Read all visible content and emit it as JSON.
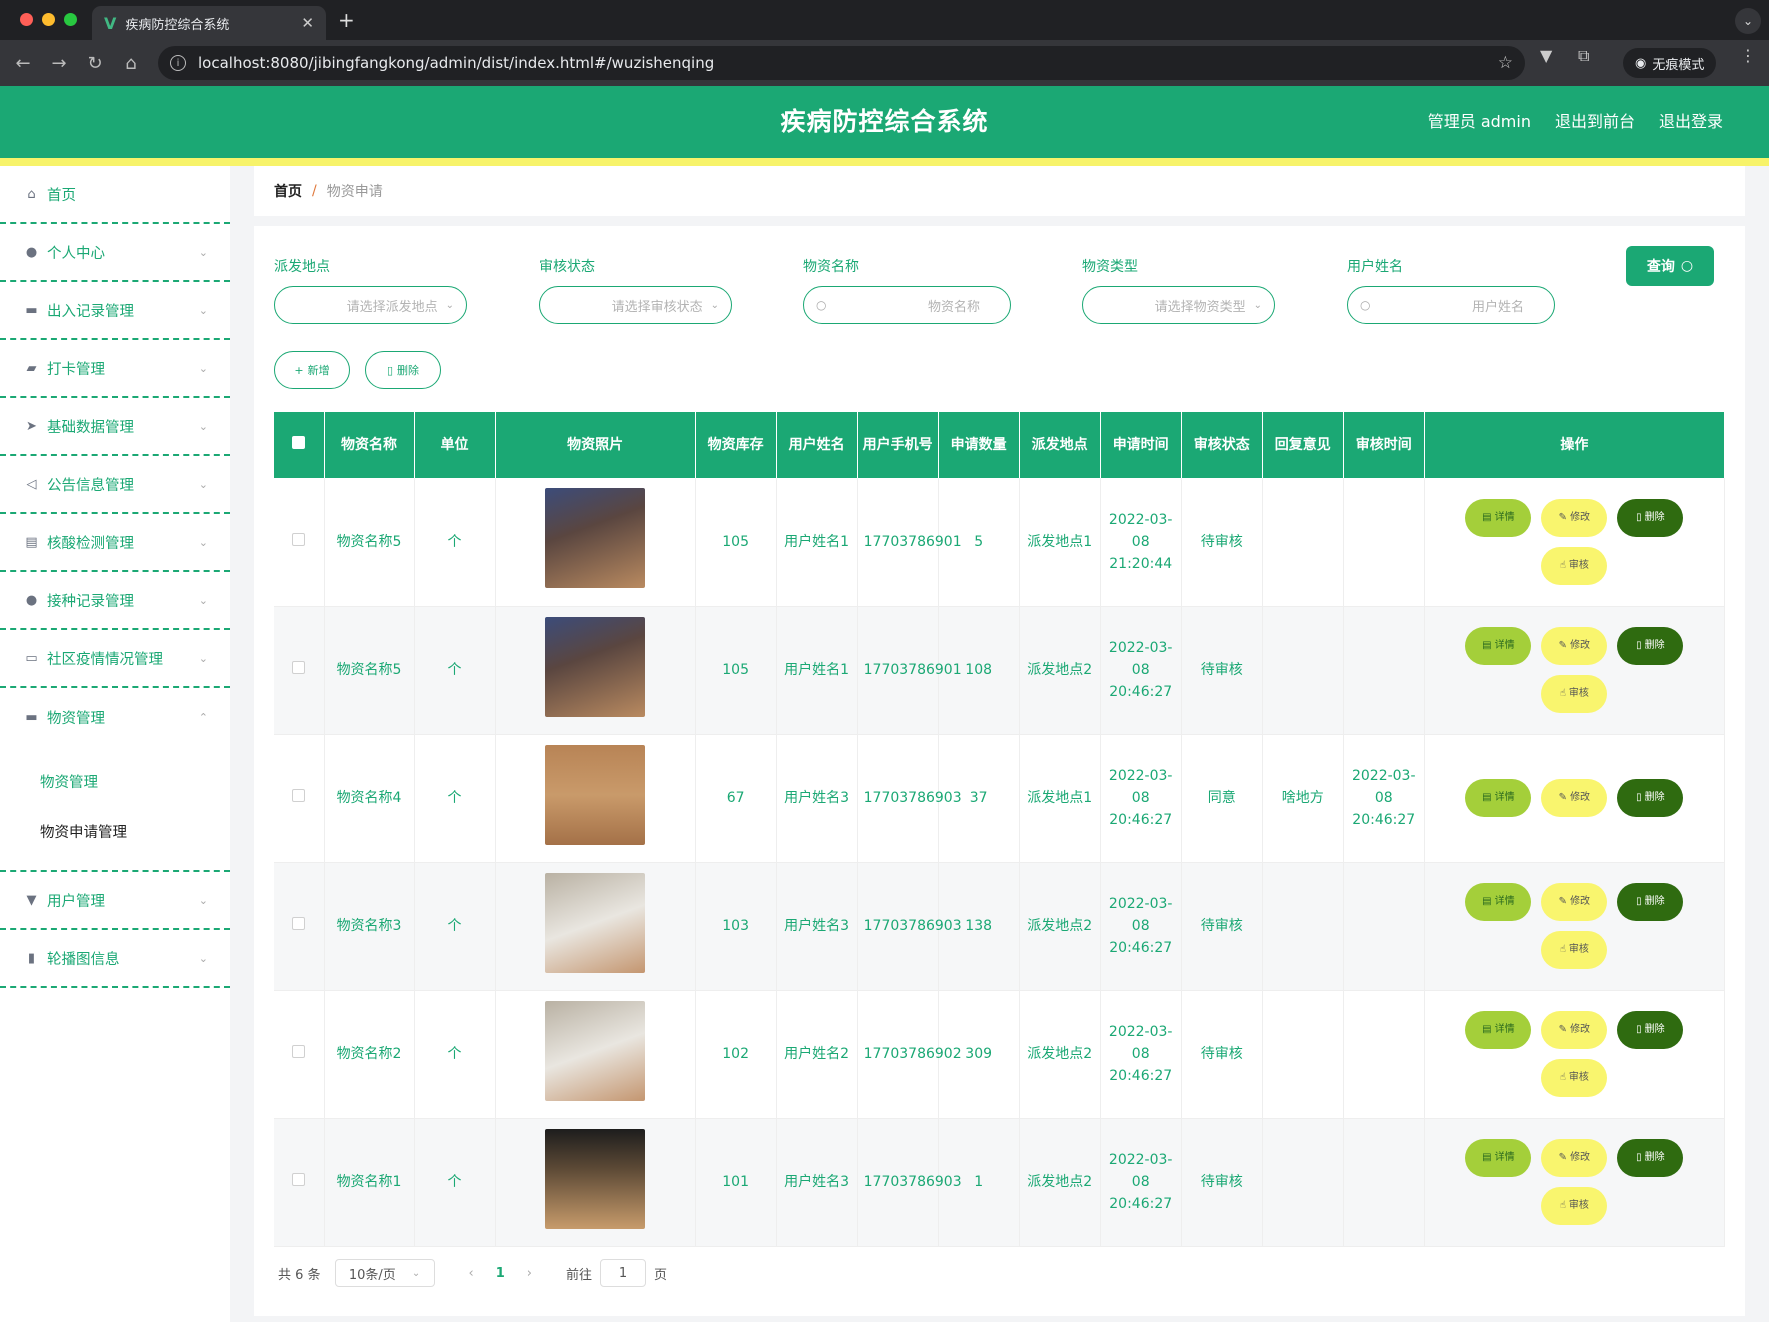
{
  "browser": {
    "tab_title": "疾病防控综合系统",
    "url": "localhost:8080/jibingfangkong/admin/dist/index.html#/wuzishenqing",
    "incognito_label": "无痕模式"
  },
  "header": {
    "title": "疾病防控综合系统",
    "user_label": "管理员 admin",
    "front_link": "退出到前台",
    "logout_link": "退出登录"
  },
  "sidebar": {
    "items": [
      {
        "label": "首页"
      },
      {
        "label": "个人中心"
      },
      {
        "label": "出入记录管理"
      },
      {
        "label": "打卡管理"
      },
      {
        "label": "基础数据管理"
      },
      {
        "label": "公告信息管理"
      },
      {
        "label": "核酸检测管理"
      },
      {
        "label": "接种记录管理"
      },
      {
        "label": "社区疫情情况管理"
      },
      {
        "label": "物资管理"
      }
    ],
    "submenu": [
      "物资管理",
      "物资申请管理"
    ],
    "items_after": [
      {
        "label": "用户管理"
      },
      {
        "label": "轮播图信息"
      }
    ]
  },
  "breadcrumb": {
    "home": "首页",
    "sep": "/",
    "current": "物资申请"
  },
  "filters": [
    {
      "label": "派发地点",
      "placeholder": "请选择派发地点"
    },
    {
      "label": "审核状态",
      "placeholder": "请选择审核状态"
    },
    {
      "label": "物资名称",
      "placeholder": "物资名称"
    },
    {
      "label": "物资类型",
      "placeholder": "请选择物资类型"
    },
    {
      "label": "用户姓名",
      "placeholder": "用户姓名"
    }
  ],
  "buttons": {
    "query": "查询",
    "add": "新增",
    "delete": "删除"
  },
  "table": {
    "headers": [
      "物资名称",
      "单位",
      "物资照片",
      "物资库存",
      "用户姓名",
      "用户手机号",
      "申请数量",
      "派发地点",
      "申请时间",
      "审核状态",
      "回复意见",
      "审核时间",
      "操作"
    ],
    "rows": [
      {
        "name": "物资名称5",
        "unit": "个",
        "stock": "105",
        "user": "用户姓名1",
        "phone": "17703786901",
        "qty": "5",
        "place": "派发地点1",
        "time": "2022-03-08 21:20:44",
        "status": "待审核",
        "reply": "",
        "audit_time": ""
      },
      {
        "name": "物资名称5",
        "unit": "个",
        "stock": "105",
        "user": "用户姓名1",
        "phone": "17703786901",
        "qty": "108",
        "place": "派发地点2",
        "time": "2022-03-08 20:46:27",
        "status": "待审核",
        "reply": "",
        "audit_time": ""
      },
      {
        "name": "物资名称4",
        "unit": "个",
        "stock": "67",
        "user": "用户姓名3",
        "phone": "17703786903",
        "qty": "37",
        "place": "派发地点1",
        "time": "2022-03-08 20:46:27",
        "status": "同意",
        "reply": "啥地方",
        "audit_time": "2022-03-08 20:46:27"
      },
      {
        "name": "物资名称3",
        "unit": "个",
        "stock": "103",
        "user": "用户姓名3",
        "phone": "17703786903",
        "qty": "138",
        "place": "派发地点2",
        "time": "2022-03-08 20:46:27",
        "status": "待审核",
        "reply": "",
        "audit_time": ""
      },
      {
        "name": "物资名称2",
        "unit": "个",
        "stock": "102",
        "user": "用户姓名2",
        "phone": "17703786902",
        "qty": "309",
        "place": "派发地点2",
        "time": "2022-03-08 20:46:27",
        "status": "待审核",
        "reply": "",
        "audit_time": ""
      },
      {
        "name": "物资名称1",
        "unit": "个",
        "stock": "101",
        "user": "用户姓名3",
        "phone": "17703786903",
        "qty": "1",
        "place": "派发地点2",
        "time": "2022-03-08 20:46:27",
        "status": "待审核",
        "reply": "",
        "audit_time": ""
      }
    ],
    "ops": {
      "detail": "详情",
      "edit": "修改",
      "delete": "删除",
      "audit": "审核"
    }
  },
  "pagination": {
    "total": "共 6 条",
    "page_size": "10条/页",
    "current_page": "1",
    "goto_prefix": "前往",
    "goto_value": "1",
    "goto_suffix": "页"
  },
  "colors": {
    "primary": "#1ba874",
    "accent_yellow": "#f9f56e",
    "delete_dark": "#2f6b10",
    "detail_green": "#a4cf3a"
  }
}
